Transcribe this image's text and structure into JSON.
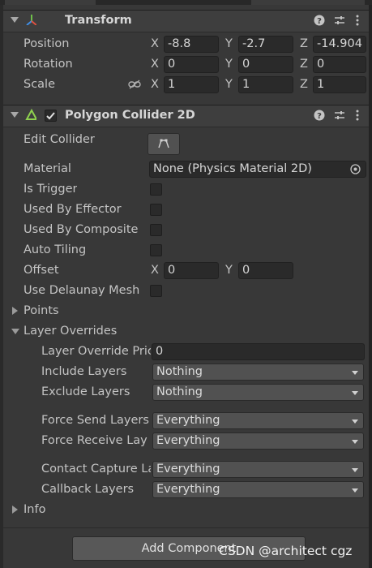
{
  "transform": {
    "title": "Transform",
    "position": {
      "label": "Position",
      "x": "-8.8",
      "y": "-2.7",
      "z": "-14.904"
    },
    "rotation": {
      "label": "Rotation",
      "x": "0",
      "y": "0",
      "z": "0"
    },
    "scale": {
      "label": "Scale",
      "x": "1",
      "y": "1",
      "z": "1"
    },
    "axis": {
      "x": "X",
      "y": "Y",
      "z": "Z"
    }
  },
  "collider": {
    "title": "Polygon Collider 2D",
    "edit_collider_label": "Edit Collider",
    "material_label": "Material",
    "material_value": "None (Physics Material 2D)",
    "is_trigger_label": "Is Trigger",
    "used_by_effector_label": "Used By Effector",
    "used_by_composite_label": "Used By Composite",
    "auto_tiling_label": "Auto Tiling",
    "offset_label": "Offset",
    "offset_x": "0",
    "offset_y": "0",
    "use_delaunay_label": "Use Delaunay Mesh",
    "points_label": "Points",
    "layer_overrides_label": "Layer Overrides",
    "layer_override_priority_label": "Layer Override Pric",
    "layer_override_priority_value": "0",
    "include_layers_label": "Include Layers",
    "include_layers_value": "Nothing",
    "exclude_layers_label": "Exclude Layers",
    "exclude_layers_value": "Nothing",
    "force_send_layers_label": "Force Send Layers",
    "force_send_layers_value": "Everything",
    "force_receive_label": "Force Receive Lay",
    "force_receive_value": "Everything",
    "contact_capture_label": "Contact Capture La",
    "contact_capture_value": "Everything",
    "callback_layers_label": "Callback Layers",
    "callback_layers_value": "Everything",
    "info_label": "Info"
  },
  "add_component_label": "Add Component",
  "watermark": "CSDN @architect cgz",
  "colors": {
    "accent_green": "#8fd14f",
    "panel_bg": "#383838",
    "field_bg": "#2a2a2a"
  }
}
